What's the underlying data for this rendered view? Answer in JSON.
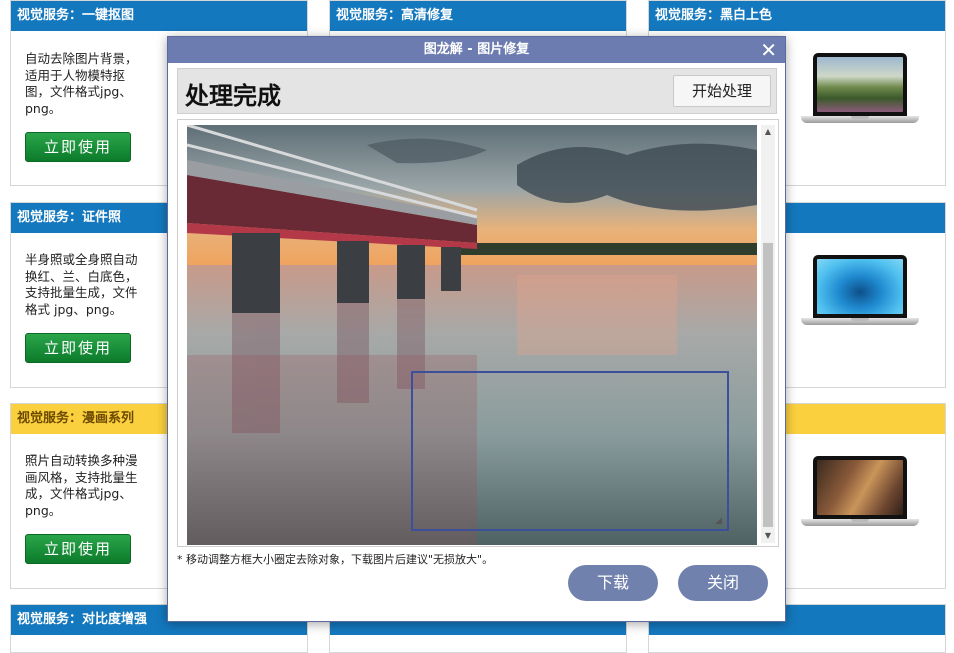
{
  "cards": [
    {
      "header": "视觉服务：一键抠图",
      "desc": "自动去除图片背景，适用于人物模特抠图，文件格式jpg、png。",
      "button": "立即使用"
    },
    {
      "header": "视觉服务：证件照",
      "desc": "半身照或全身照自动换红、兰、白底色，支持批量生成，文件格式 jpg、png。",
      "button": "立即使用"
    },
    {
      "header": "视觉服务：漫画系列",
      "desc": "照片自动转换多种漫画风格，支持批量生成，文件格式jpg、png。",
      "button": "立即使用"
    },
    {
      "header": "视觉服务：对比度增强"
    }
  ],
  "top_headers": {
    "middle": "视觉服务：高清修复",
    "right": "视觉服务：黑白上色"
  },
  "dialog": {
    "title": "图龙解 - 图片修复",
    "close_symbol": "✕",
    "status": "处理完成",
    "start_button": "开始处理",
    "hint": "* 移动调整方框大小圈定去除对象，下载图片后建议\"无损放大\"。",
    "download_button": "下载",
    "close_button": "关闭"
  },
  "colors": {
    "header_blue": "#1478be",
    "header_yellow": "#fbd03e",
    "button_green": "#12883a",
    "dialog_accent": "#6c7cb0"
  }
}
